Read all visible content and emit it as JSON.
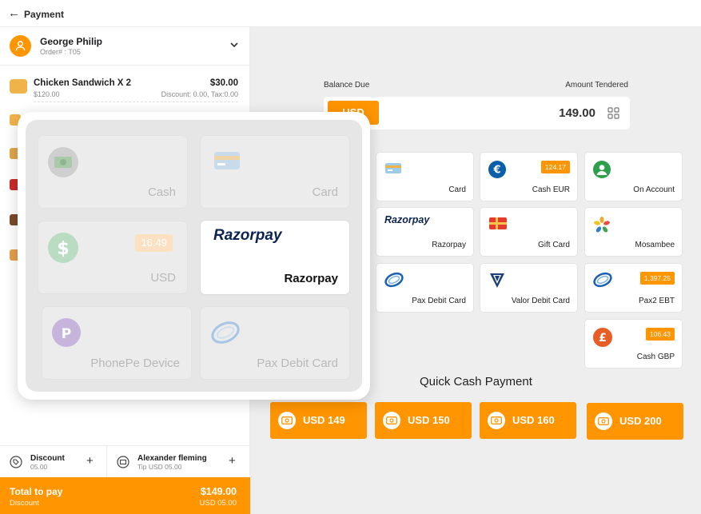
{
  "header": {
    "back_icon": "arrow-left-icon",
    "title": "Payment"
  },
  "customer": {
    "name": "George Philip",
    "order": "Order# : T05"
  },
  "order_items": [
    {
      "name": "Chicken Sandwich X 2",
      "sub": "$120.00",
      "price": "$30.00",
      "discount": "Discount: 0.00, Tax:0.00"
    }
  ],
  "footer_actions": {
    "discount": {
      "title": "Discount",
      "sub": "05.00"
    },
    "tip": {
      "title": "Alexander fleming",
      "sub": "Tip USD 05.00"
    }
  },
  "total": {
    "label": "Total to pay",
    "sub": "Discount",
    "amount": "$149.00",
    "amount_sub": "USD 05.00"
  },
  "balance": {
    "label": "Balance Due",
    "tendered_label": "Amount Tendered",
    "currency": "USD",
    "value": "149.00"
  },
  "payment_tiles": [
    {
      "label": "Card",
      "icon": "credit-card-icon",
      "badge": ""
    },
    {
      "label": "Cash EUR",
      "icon": "euro-icon",
      "badge": "124.17"
    },
    {
      "label": "On Account",
      "icon": "user-icon",
      "badge": ""
    },
    {
      "label": "Razorpay",
      "icon": "razorpay-logo",
      "badge": "",
      "logo_text": "Razorpay"
    },
    {
      "label": "Gift Card",
      "icon": "gift-card-icon",
      "badge": ""
    },
    {
      "label": "Mosambee",
      "icon": "mosambee-logo",
      "badge": ""
    },
    {
      "label": "Pax Debit Card",
      "icon": "pax-icon",
      "badge": ""
    },
    {
      "label": "Valor Debit Card",
      "icon": "valor-icon",
      "badge": ""
    },
    {
      "label": "Pax2 EBT",
      "icon": "pax-icon",
      "badge": "1,397.25"
    },
    {
      "label": "Cash GBP",
      "icon": "pound-icon",
      "badge": "106.43"
    }
  ],
  "quick_cash": {
    "title": "Quick Cash Payment",
    "buttons": [
      "USD 149",
      "USD 150",
      "USD 160",
      "USD 200"
    ]
  },
  "overlay_tiles": [
    {
      "label": "Cash",
      "icon": "cash-icon",
      "badge": ""
    },
    {
      "label": "Card",
      "icon": "credit-card-icon",
      "badge": ""
    },
    {
      "label": "USD",
      "icon": "dollar-icon",
      "badge": "16.49"
    },
    {
      "label": "Razorpay",
      "icon": "razorpay-logo",
      "badge": "",
      "logo_text": "Razorpay"
    },
    {
      "label": "PhonePe Device",
      "icon": "phonepe-icon",
      "badge": ""
    },
    {
      "label": "Pax Debit Card",
      "icon": "pax-icon",
      "badge": ""
    }
  ],
  "colors": {
    "accent": "#ff9500",
    "razorpay_blue": "#0c2451",
    "panel_bg": "#eeeeee"
  }
}
